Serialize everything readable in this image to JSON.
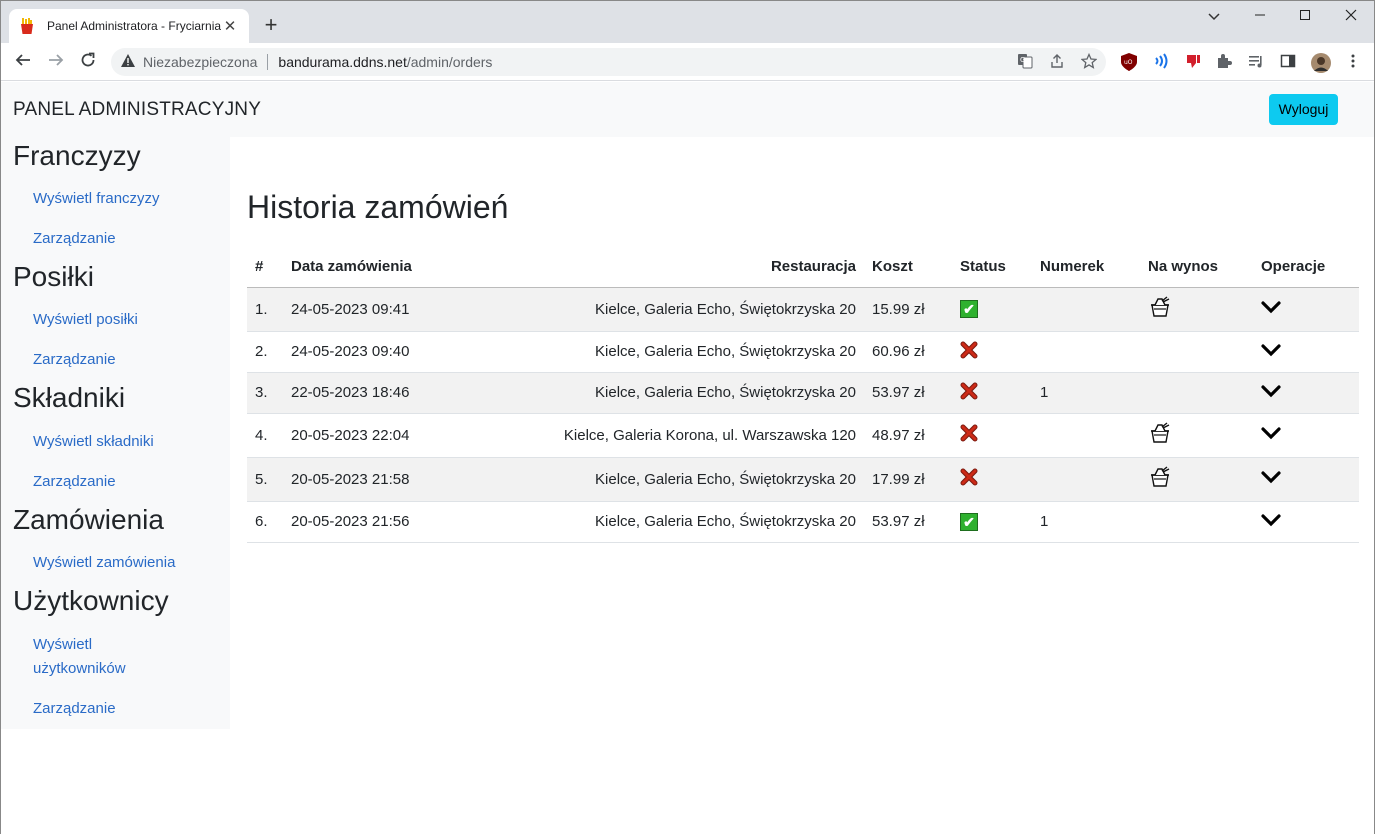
{
  "browser": {
    "tab_title": "Panel Administratora - Fryciarnia",
    "insecure_label": "Niezabezpieczona",
    "url_host": "bandurama.ddns.net",
    "url_path": "/admin/orders"
  },
  "navbar": {
    "brand": "PANEL ADMINISTRACYJNY",
    "logout_label": "Wyloguj"
  },
  "sidebar": {
    "sections": [
      {
        "title": "Franczyzy",
        "links": [
          "Wyświetl franczyzy",
          "Zarządzanie"
        ]
      },
      {
        "title": "Posiłki",
        "links": [
          "Wyświetl posiłki",
          "Zarządzanie"
        ]
      },
      {
        "title": "Składniki",
        "links": [
          "Wyświetl składniki",
          "Zarządzanie"
        ]
      },
      {
        "title": "Zamówienia",
        "links": [
          "Wyświetl zamówienia"
        ]
      },
      {
        "title": "Użytkownicy",
        "links": [
          "Wyświetl",
          "użytkowników",
          "Zarządzanie"
        ]
      }
    ]
  },
  "main": {
    "title": "Historia zamówień",
    "columns": [
      "#",
      "Data zamówienia",
      "Restauracja",
      "Koszt",
      "Status",
      "Numerek",
      "Na wynos",
      "Operacje"
    ],
    "rows": [
      {
        "n": "1.",
        "date": "24-05-2023 09:41",
        "restaurant": "Kielce, Galeria Echo, Świętokrzyska 20",
        "cost": "15.99 zł",
        "status": "ok",
        "number": "",
        "takeaway": true
      },
      {
        "n": "2.",
        "date": "24-05-2023 09:40",
        "restaurant": "Kielce, Galeria Echo, Świętokrzyska 20",
        "cost": "60.96 zł",
        "status": "cancelled",
        "number": "",
        "takeaway": false
      },
      {
        "n": "3.",
        "date": "22-05-2023 18:46",
        "restaurant": "Kielce, Galeria Echo, Świętokrzyska 20",
        "cost": "53.97 zł",
        "status": "cancelled",
        "number": "1",
        "takeaway": false
      },
      {
        "n": "4.",
        "date": "20-05-2023 22:04",
        "restaurant": "Kielce, Galeria Korona, ul. Warszawska 120",
        "cost": "48.97 zł",
        "status": "cancelled",
        "number": "",
        "takeaway": true
      },
      {
        "n": "5.",
        "date": "20-05-2023 21:58",
        "restaurant": "Kielce, Galeria Echo, Świętokrzyska 20",
        "cost": "17.99 zł",
        "status": "cancelled",
        "number": "",
        "takeaway": true
      },
      {
        "n": "6.",
        "date": "20-05-2023 21:56",
        "restaurant": "Kielce, Galeria Echo, Świętokrzyska 20",
        "cost": "53.97 zł",
        "status": "ok",
        "number": "1",
        "takeaway": false
      }
    ]
  },
  "colors": {
    "link": "#2a6bc7",
    "logout_button": "#0dcaf0",
    "status_ok": "#2fb12f",
    "status_cancelled": "#cc2a17"
  },
  "icons": {
    "status_ok": "check-box-icon",
    "status_cancelled": "cross-icon",
    "takeaway": "takeaway-box-icon",
    "operations": "chevron-down-icon"
  }
}
